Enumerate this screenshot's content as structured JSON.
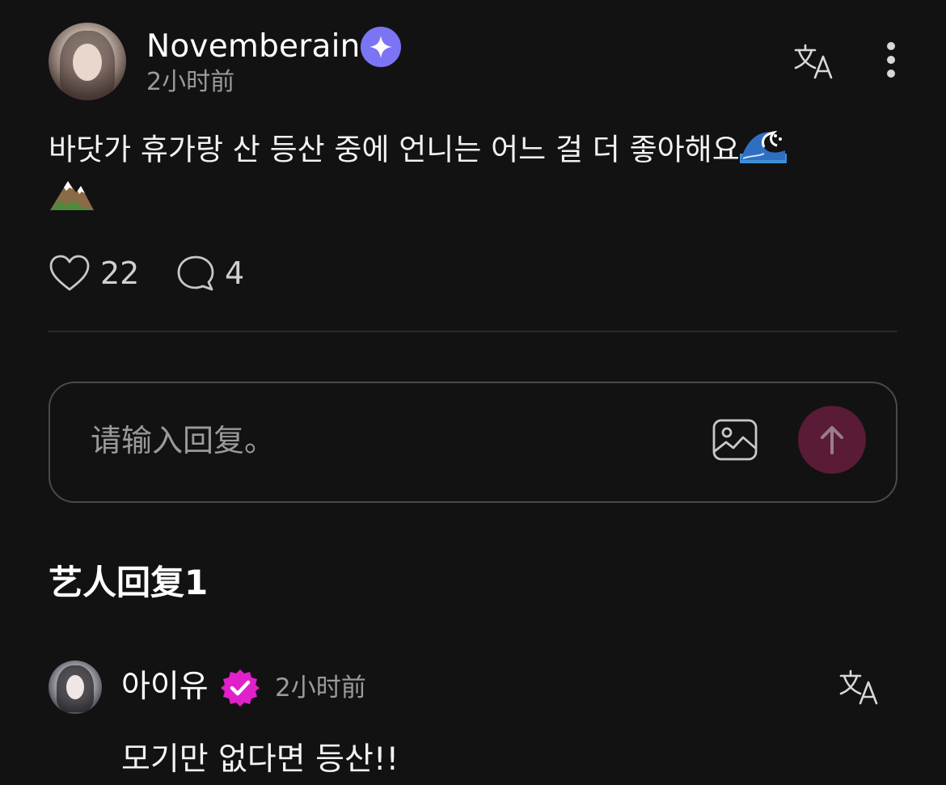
{
  "post": {
    "username": "Novemberain",
    "time": "2小时前",
    "text": "바닷가 휴가랑 산 등산 중에 언니는 어느 걸 더 좋아해요",
    "likes": "22",
    "comments": "4",
    "icons": [
      "star-badge-icon",
      "translate-icon",
      "more-icon",
      "wave-emoji",
      "mountain-emoji",
      "heart-icon",
      "comment-icon"
    ]
  },
  "reply_input": {
    "placeholder": "请输入回复。",
    "icons": [
      "image-icon",
      "arrow-up-icon"
    ],
    "send_color": "#5a1b36"
  },
  "section": {
    "title": "艺人回复1"
  },
  "artist_reply": {
    "name": "아이유",
    "time": "2小时前",
    "text": "모기만 없다면 등산!!",
    "badge_color": "#e020c8"
  },
  "colors": {
    "background": "#121213",
    "star_badge": "#7b74f5"
  }
}
